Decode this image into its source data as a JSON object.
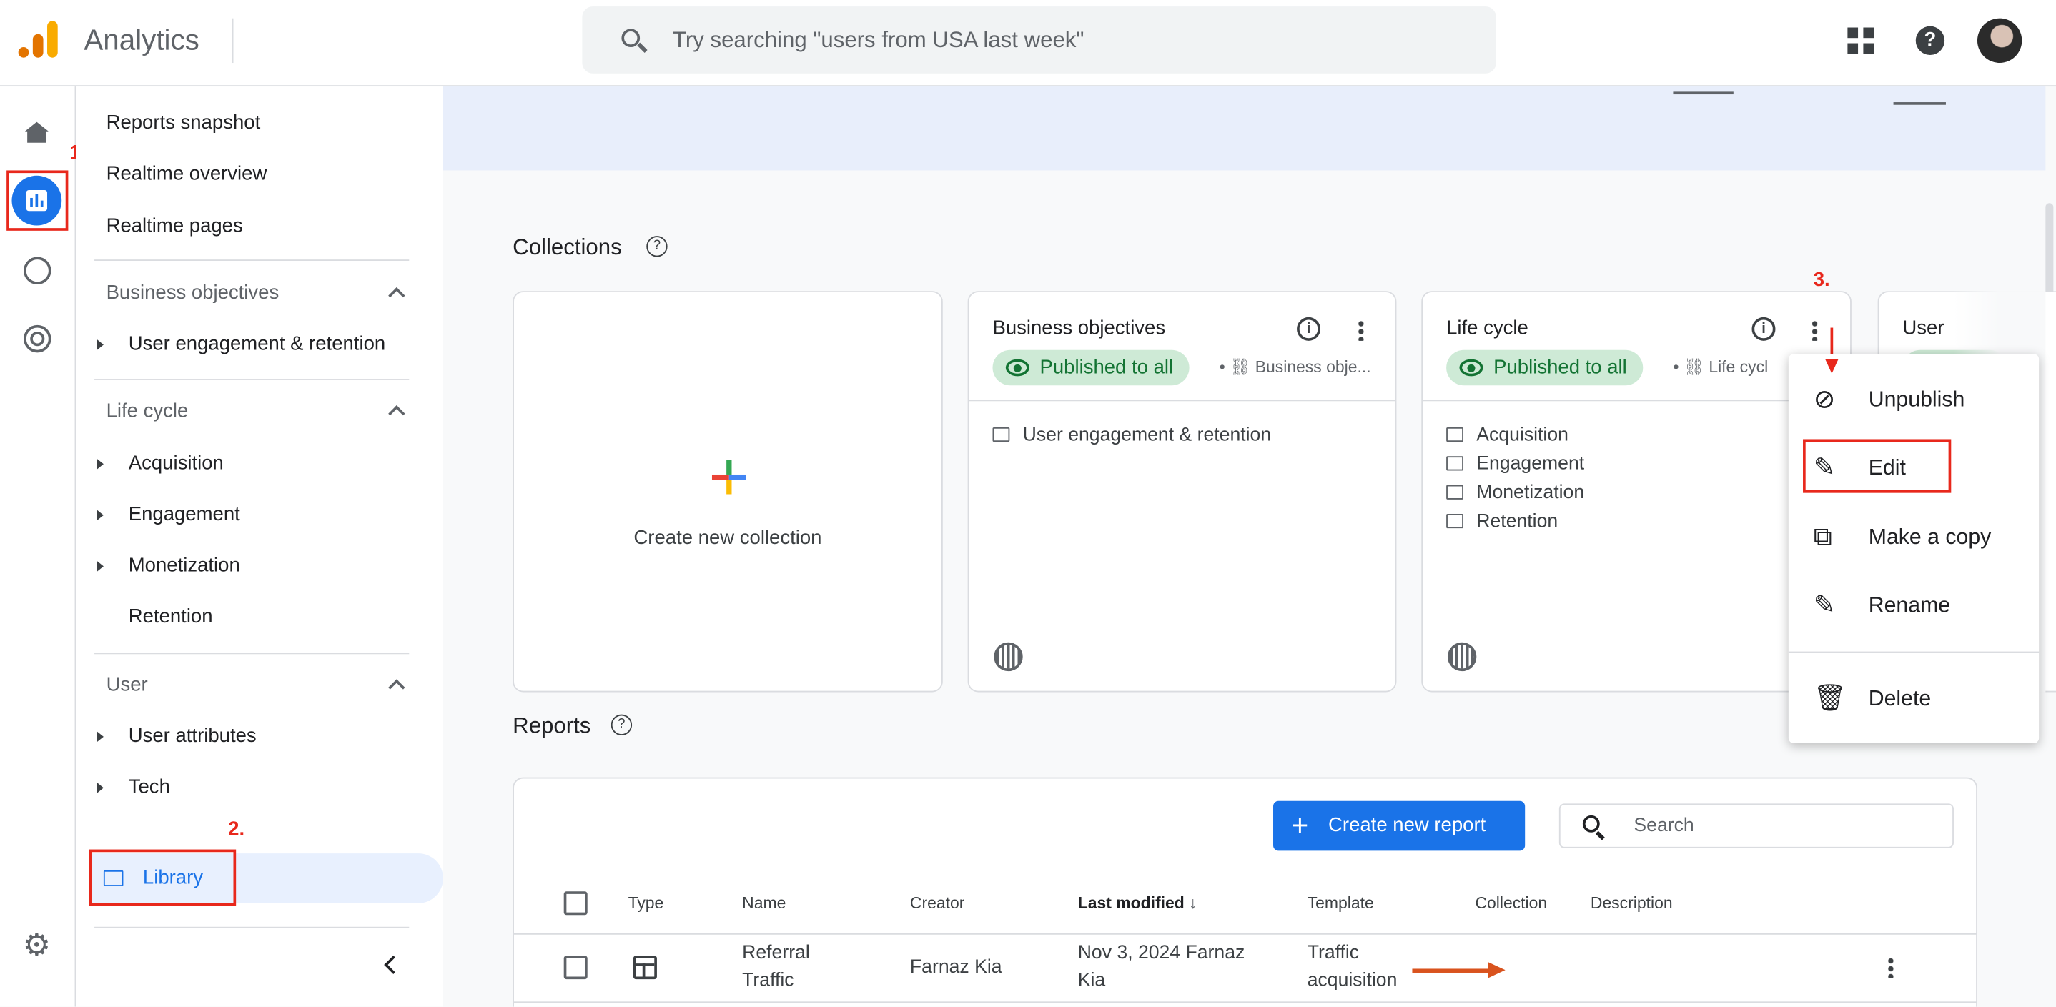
{
  "header": {
    "app_name": "Analytics",
    "search_placeholder": "Try searching \"users from USA last week\""
  },
  "rail": {
    "items": [
      "home-icon",
      "reports-icon",
      "explore-icon",
      "advertising-icon",
      "settings-icon"
    ],
    "active": "reports-icon"
  },
  "nav": {
    "top_items": [
      "Reports snapshot",
      "Realtime overview",
      "Realtime pages"
    ],
    "sections": [
      {
        "title": "Business objectives",
        "items": [
          {
            "label": "User engagement & retention",
            "expandable": true
          }
        ]
      },
      {
        "title": "Life cycle",
        "items": [
          {
            "label": "Acquisition",
            "expandable": true
          },
          {
            "label": "Engagement",
            "expandable": true
          },
          {
            "label": "Monetization",
            "expandable": true
          },
          {
            "label": "Retention",
            "expandable": false
          }
        ]
      },
      {
        "title": "User",
        "items": [
          {
            "label": "User attributes",
            "expandable": true
          },
          {
            "label": "Tech",
            "expandable": true
          }
        ]
      }
    ],
    "library": "Library"
  },
  "annotations": {
    "step1": "1.",
    "step2": "2.",
    "step3": "3.",
    "accent_red": "#e8281c",
    "arrow_orange": "#d9531e"
  },
  "collections": {
    "title": "Collections",
    "create_label": "Create new collection",
    "cards": [
      {
        "title": "Business objectives",
        "status": "Published to all",
        "template": "Business obje...",
        "folders": [
          "User engagement & retention"
        ]
      },
      {
        "title": "Life cycle",
        "status": "Published to all",
        "template": "Life cycl",
        "folders": [
          "Acquisition",
          "Engagement",
          "Monetization",
          "Retention"
        ]
      },
      {
        "title": "User"
      }
    ]
  },
  "menu": {
    "items": [
      "Unpublish",
      "Edit",
      "Make a copy",
      "Rename",
      "Delete"
    ],
    "highlighted": "Edit"
  },
  "reports": {
    "title": "Reports",
    "create_button": "Create new report",
    "search_placeholder": "Search",
    "columns": [
      "Type",
      "Name",
      "Creator",
      "Last modified",
      "Template",
      "Collection",
      "Description"
    ],
    "sort_column": "Last modified",
    "rows": [
      {
        "name": "Referral Traffic",
        "creator": "Farnaz Kia",
        "last_modified": "Nov 3, 2024 Farnaz Kia",
        "template": "Traffic acquisition",
        "collection": "",
        "description": ""
      }
    ]
  },
  "colors": {
    "primary": "#1a73e8",
    "published_bg": "#ceead6",
    "published_text": "#137333",
    "selected_bg": "#e8f0fe"
  }
}
